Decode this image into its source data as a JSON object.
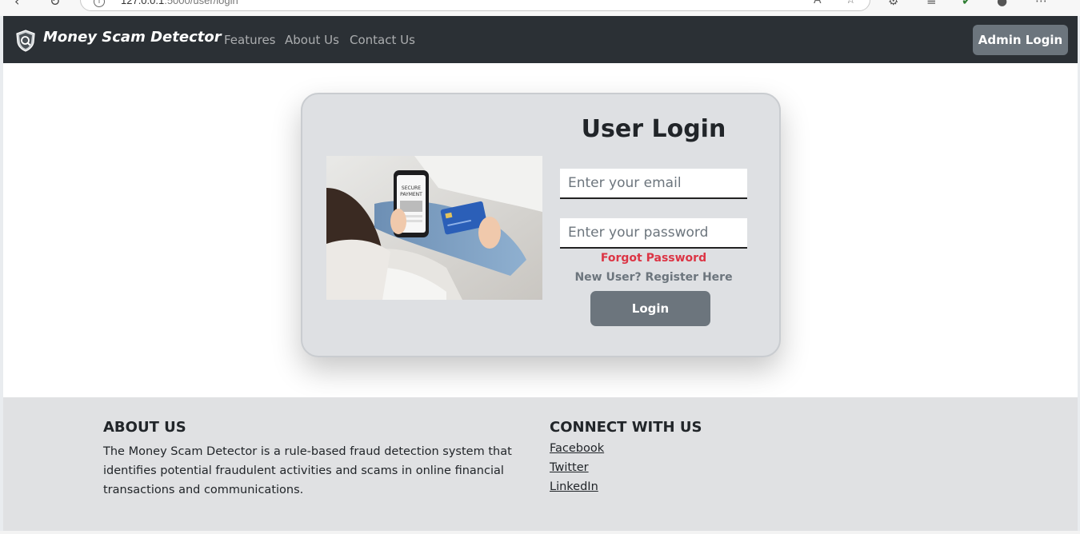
{
  "browser": {
    "url_host": "127.0.0.1",
    "url_rest": ":5000/user/login"
  },
  "navbar": {
    "brand": "Money Scam Detector",
    "links": [
      "Features",
      "About Us",
      "Contact Us"
    ],
    "admin_button": "Admin Login"
  },
  "login": {
    "title": "User Login",
    "email_placeholder": "Enter your email",
    "password_placeholder": "Enter your password",
    "forgot": "Forgot Password",
    "register": "New User? Register Here",
    "button": "Login",
    "image_text": [
      "SECURE",
      "PAYMENT"
    ]
  },
  "footer": {
    "about_heading": "ABOUT US",
    "about_text": "The Money Scam Detector is a rule-based fraud detection system that identifies potential fraudulent activities and scams in online financial transactions and communications.",
    "connect_heading": "CONNECT WITH US",
    "social": [
      "Facebook",
      "Twitter",
      "LinkedIn"
    ]
  },
  "colors": {
    "navbar_bg": "#2b3035",
    "secondary": "#6c757d",
    "danger": "#dc3545",
    "card_bg": "#dee0e3",
    "footer_bg": "#e0e1e3"
  }
}
